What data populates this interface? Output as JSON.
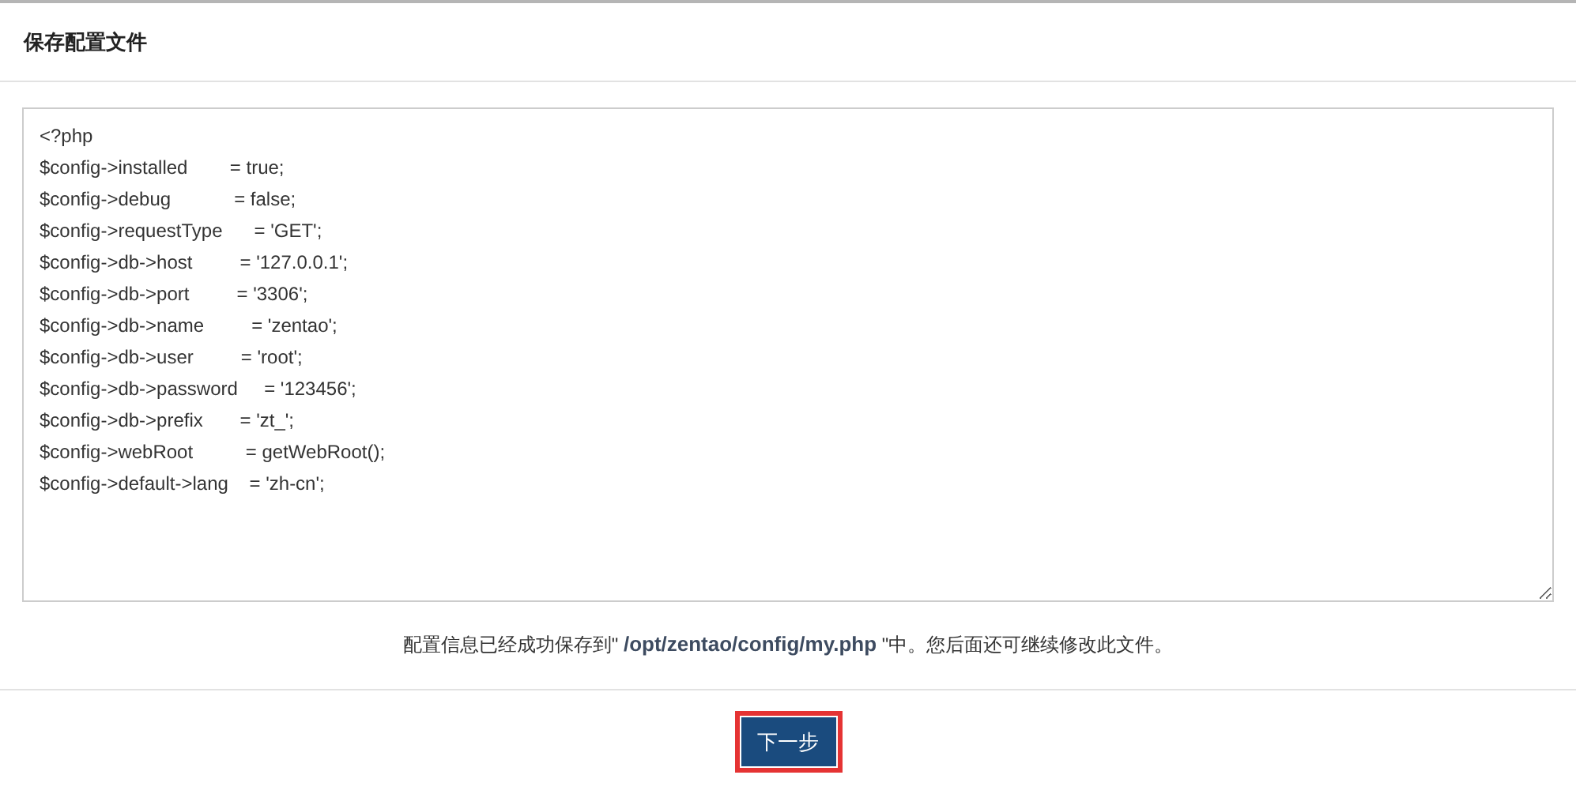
{
  "panel": {
    "title": "保存配置文件"
  },
  "config_file": {
    "lines": [
      "<?php",
      "$config->installed        = true;",
      "$config->debug            = false;",
      "$config->requestType      = 'GET';",
      "$config->db->host         = '127.0.0.1';",
      "$config->db->port         = '3306';",
      "$config->db->name         = 'zentao';",
      "$config->db->user         = 'root';",
      "$config->db->password     = '123456';",
      "$config->db->prefix       = 'zt_';",
      "$config->webRoot          = getWebRoot();",
      "$config->default->lang    = 'zh-cn';"
    ]
  },
  "message": "配置信息已经成功保存到\" **/opt/zentao/config/my.php** \"中。您后面还可继续修改此文件。",
  "next_button": {
    "label": "下一步"
  }
}
